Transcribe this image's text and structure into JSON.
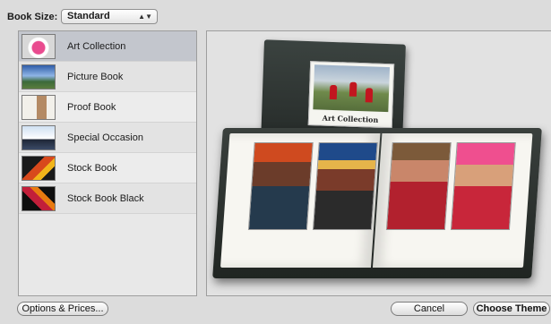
{
  "book_size": {
    "label": "Book Size:",
    "selected": "Standard"
  },
  "themes": [
    {
      "label": "Art Collection",
      "thumb": "art-collection-thumbnail"
    },
    {
      "label": "Picture Book",
      "thumb": "picture-book-thumbnail"
    },
    {
      "label": "Proof Book",
      "thumb": "proof-book-thumbnail"
    },
    {
      "label": "Special Occasion",
      "thumb": "special-occasion-thumbnail"
    },
    {
      "label": "Stock Book",
      "thumb": "stock-book-thumbnail"
    },
    {
      "label": "Stock Book Black",
      "thumb": "stock-book-black-thumbnail"
    }
  ],
  "selected_theme": "Art Collection",
  "preview": {
    "cover_title": "Art Collection"
  },
  "buttons": {
    "options": "Options & Prices...",
    "cancel": "Cancel",
    "choose": "Choose Theme"
  },
  "colors": {
    "selection": "#c3c6cd",
    "book_cover": "#2c3230"
  }
}
